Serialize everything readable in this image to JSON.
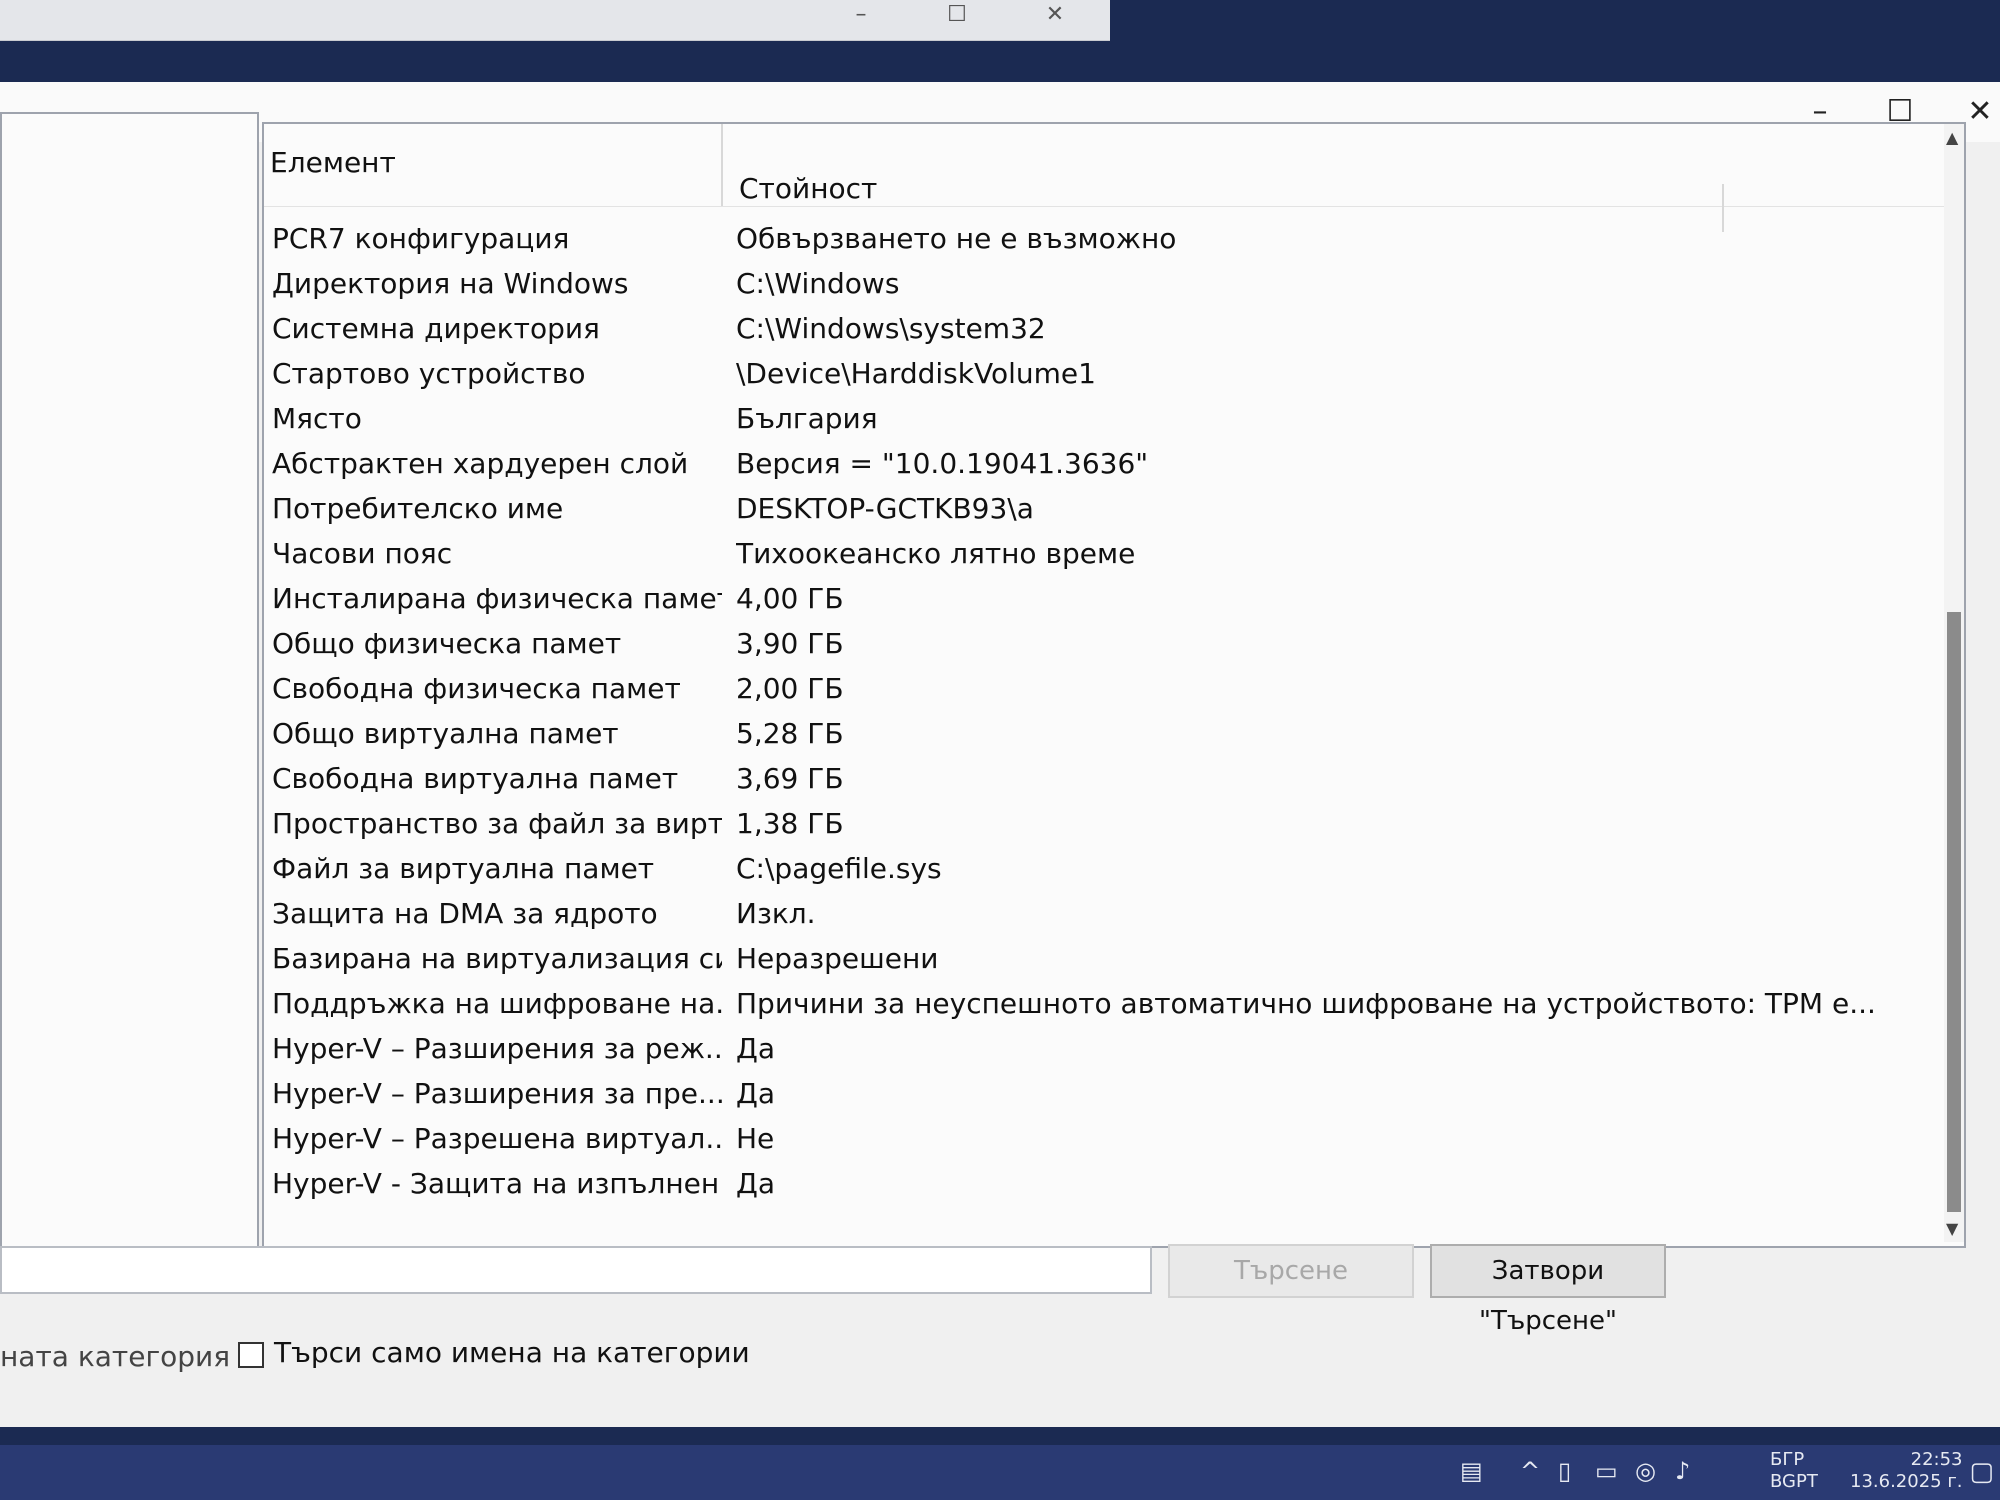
{
  "list": {
    "headers": {
      "element": "Елемент",
      "value": "Стойност"
    },
    "rows": [
      {
        "element": "PCR7 конфигурация",
        "value": "Обвързването не е възможно"
      },
      {
        "element": "Директория на Windows",
        "value": "C:\\Windows"
      },
      {
        "element": "Системна директория",
        "value": "C:\\Windows\\system32"
      },
      {
        "element": "Стартово устройство",
        "value": "\\Device\\HarddiskVolume1"
      },
      {
        "element": "Място",
        "value": "България"
      },
      {
        "element": "Абстрактен хардуерен слой",
        "value": "Версия = \"10.0.19041.3636\""
      },
      {
        "element": "Потребителско име",
        "value": "DESKTOP-GCTKB93\\a"
      },
      {
        "element": "Часови пояс",
        "value": "Тихоокеанско лятно време"
      },
      {
        "element": "Инсталирана физическа памет...",
        "value": "4,00 ГБ"
      },
      {
        "element": "Общо физическа памет",
        "value": "3,90 ГБ"
      },
      {
        "element": "Свободна физическа памет",
        "value": "2,00 ГБ"
      },
      {
        "element": "Общо виртуална памет",
        "value": "5,28 ГБ"
      },
      {
        "element": "Свободна виртуална памет",
        "value": "3,69 ГБ"
      },
      {
        "element": "Пространство за файл за вирт...",
        "value": "1,38 ГБ"
      },
      {
        "element": "Файл за виртуална памет",
        "value": "C:\\pagefile.sys"
      },
      {
        "element": "Защита на DMA за ядрото",
        "value": "Изкл."
      },
      {
        "element": "Базирана на виртуализация си...",
        "value": "Неразрешени"
      },
      {
        "element": "Поддръжка на шифроване на...",
        "value": "Причини за неуспешното автоматично шифроване на устройството: TPM е..."
      },
      {
        "element": "Hyper-V – Разширения за реж...",
        "value": "Да"
      },
      {
        "element": "Hyper-V – Разширения за пре...",
        "value": "Да"
      },
      {
        "element": "Hyper-V – Разрешена виртуал...",
        "value": "Не"
      },
      {
        "element": "Hyper-V - Защита на изпълнен...",
        "value": "Да"
      }
    ]
  },
  "search": {
    "input_value": "",
    "search_button": "Търсене",
    "close_search_button": "Затвори \"Търсене\""
  },
  "options": {
    "selected_category_fragment": "ната категория",
    "category_names_only_label": "Търси само имена на категории"
  },
  "taskbar": {
    "lang_top": "БГР",
    "lang_bottom": "BGPT",
    "time": "22:53",
    "date": "13.6.2025 г."
  },
  "icons": {
    "minimize": "minimize-icon",
    "maximize": "maximize-icon",
    "close": "close-icon"
  }
}
